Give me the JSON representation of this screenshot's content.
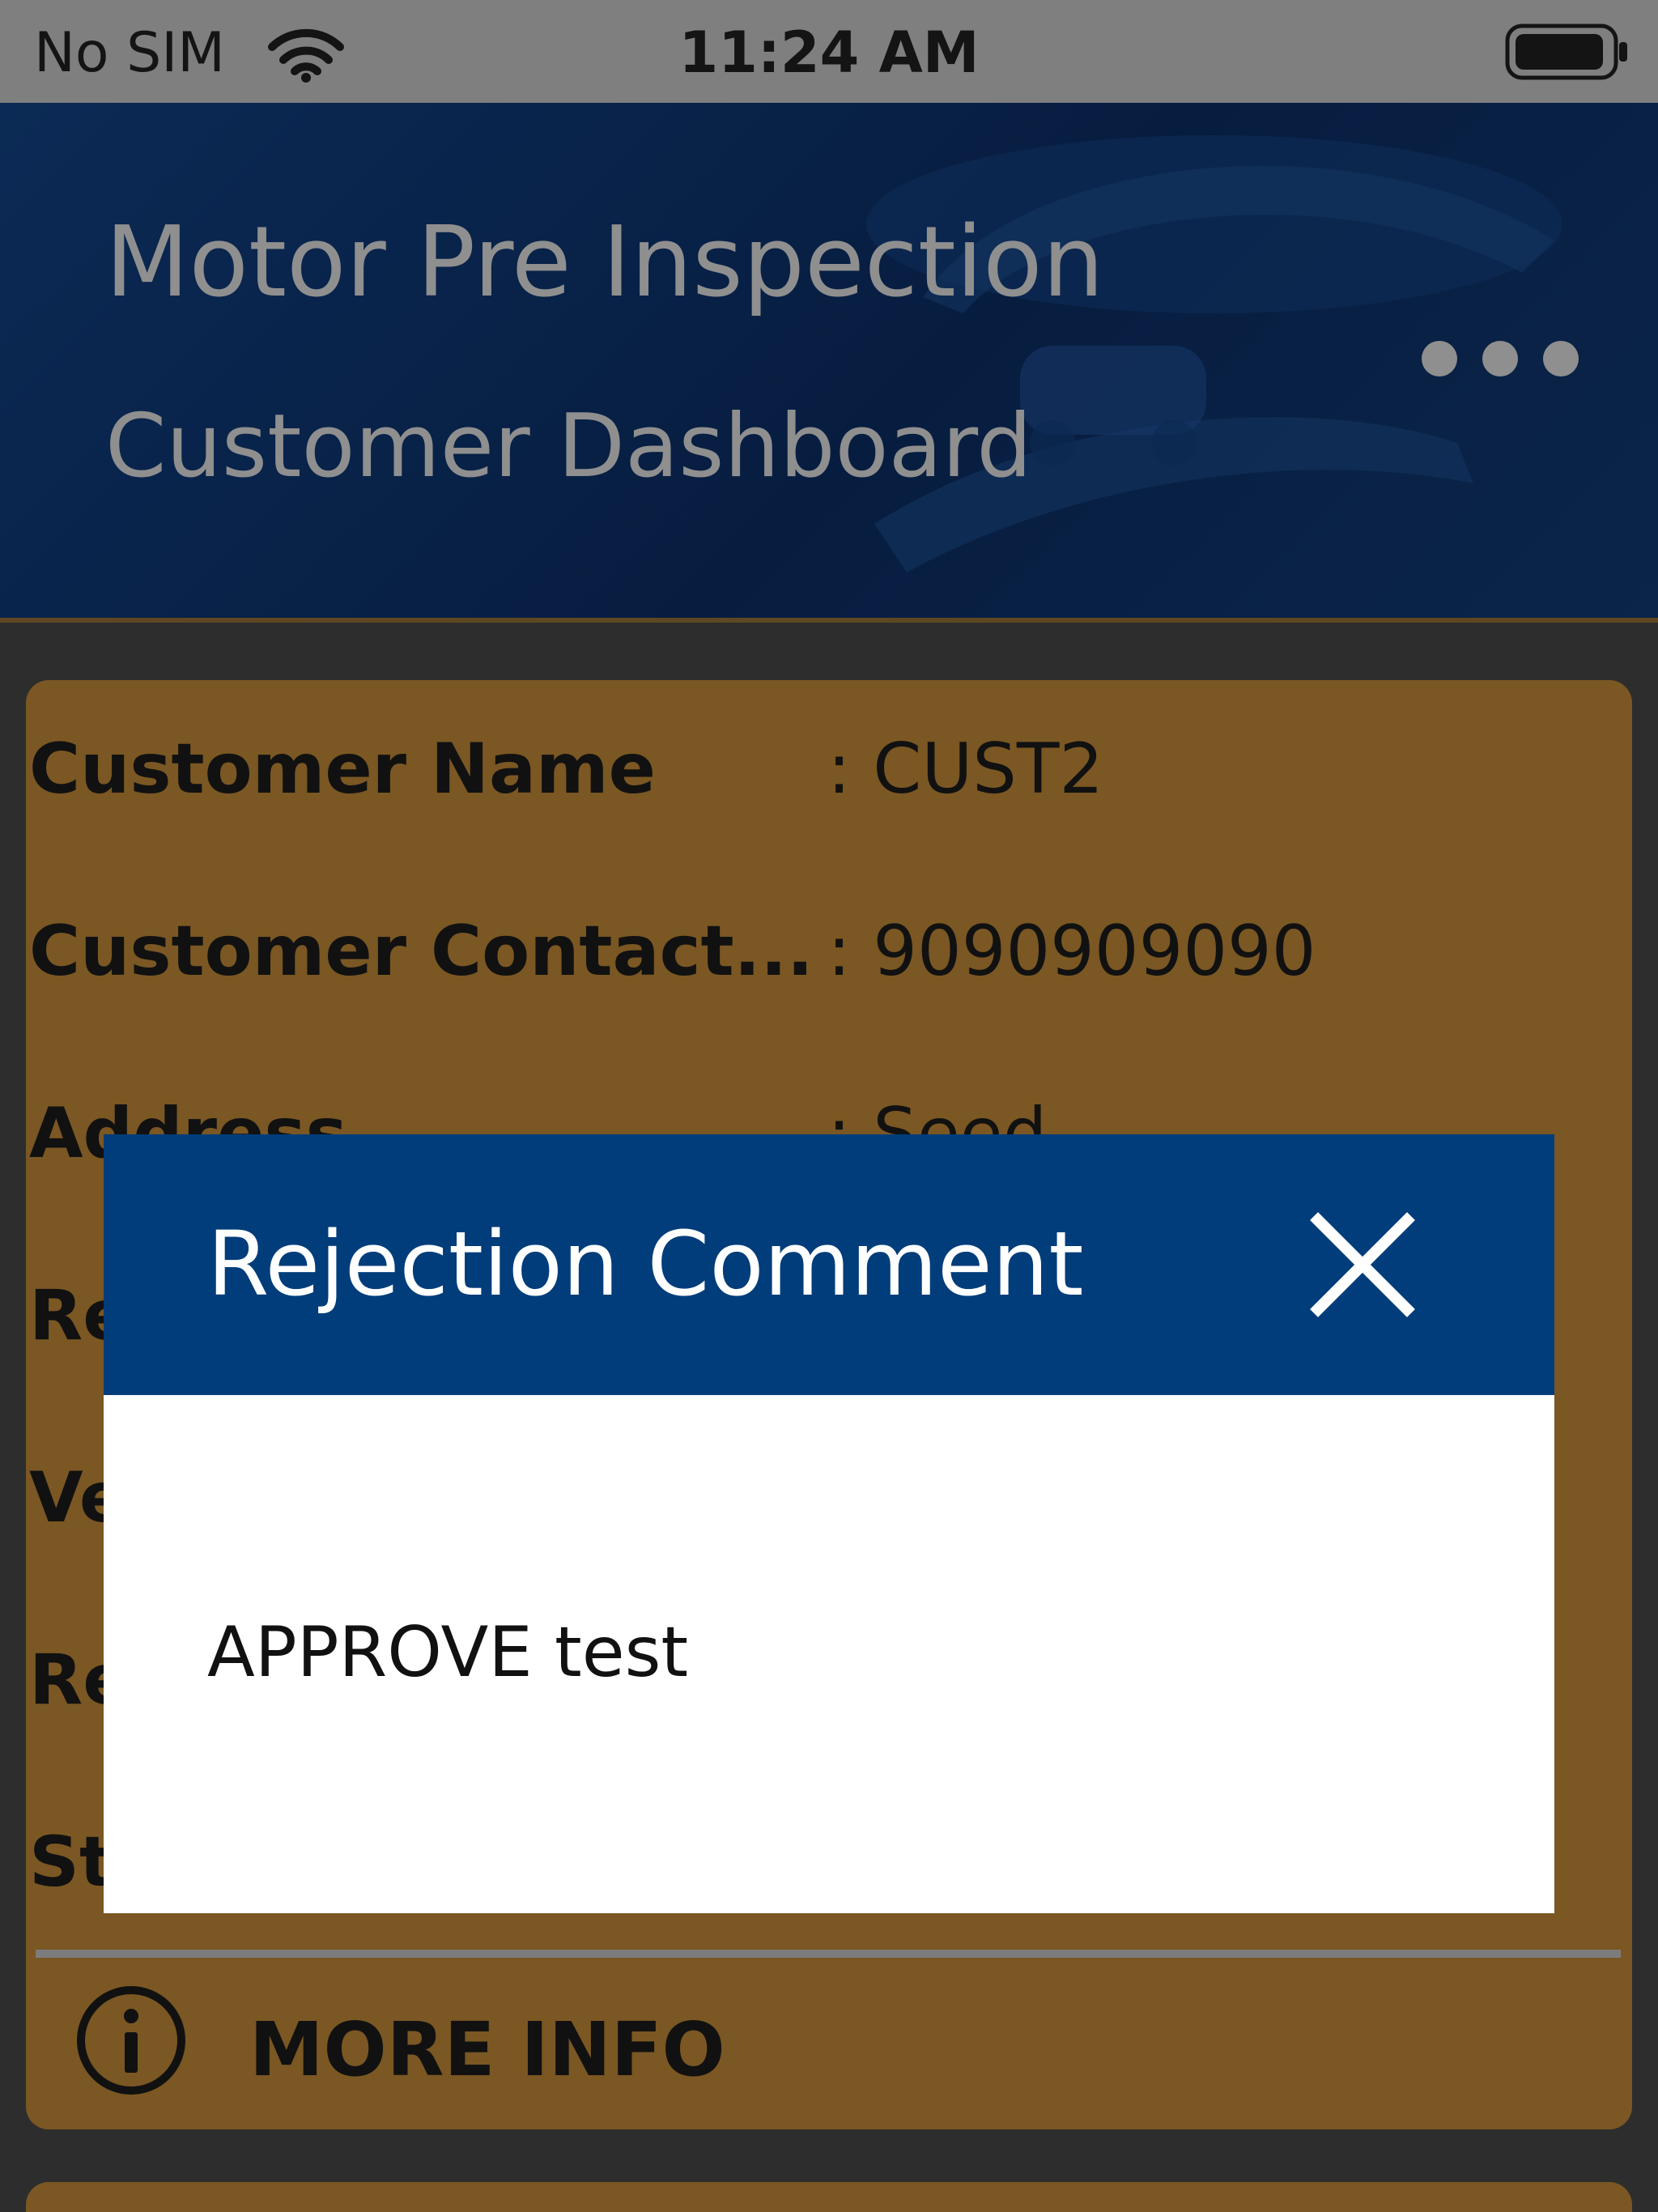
{
  "status_bar": {
    "carrier": "No SIM",
    "time": "11:24 AM",
    "wifi_icon": "wifi-icon",
    "battery_icon": "battery-icon"
  },
  "header": {
    "title": "Motor Pre Inspection",
    "subtitle": "Customer Dashboard",
    "menu_icon": "more-horizontal-icon"
  },
  "customer_card": {
    "fields": [
      {
        "label": "Customer Name",
        "value": ": CUST2"
      },
      {
        "label": "Customer Contact...",
        "value": ": 9090909090"
      },
      {
        "label": "Address",
        "value": ": Seed"
      },
      {
        "label": "Re",
        "value": ""
      },
      {
        "label": "Ve",
        "value": ""
      },
      {
        "label": "Re",
        "value": ""
      },
      {
        "label": "St",
        "value": ""
      }
    ],
    "more_info_label": "MORE INFO",
    "more_info_icon": "info-icon"
  },
  "modal": {
    "title": "Rejection Comment",
    "close_icon": "close-icon",
    "comment": "APPROVE test"
  },
  "colors": {
    "status_bar": "#7f7f7f",
    "header_bg": "#071d40",
    "card_bg": "#7a5723",
    "modal_header": "#003d7a",
    "page_bg": "#2d2d2d"
  }
}
